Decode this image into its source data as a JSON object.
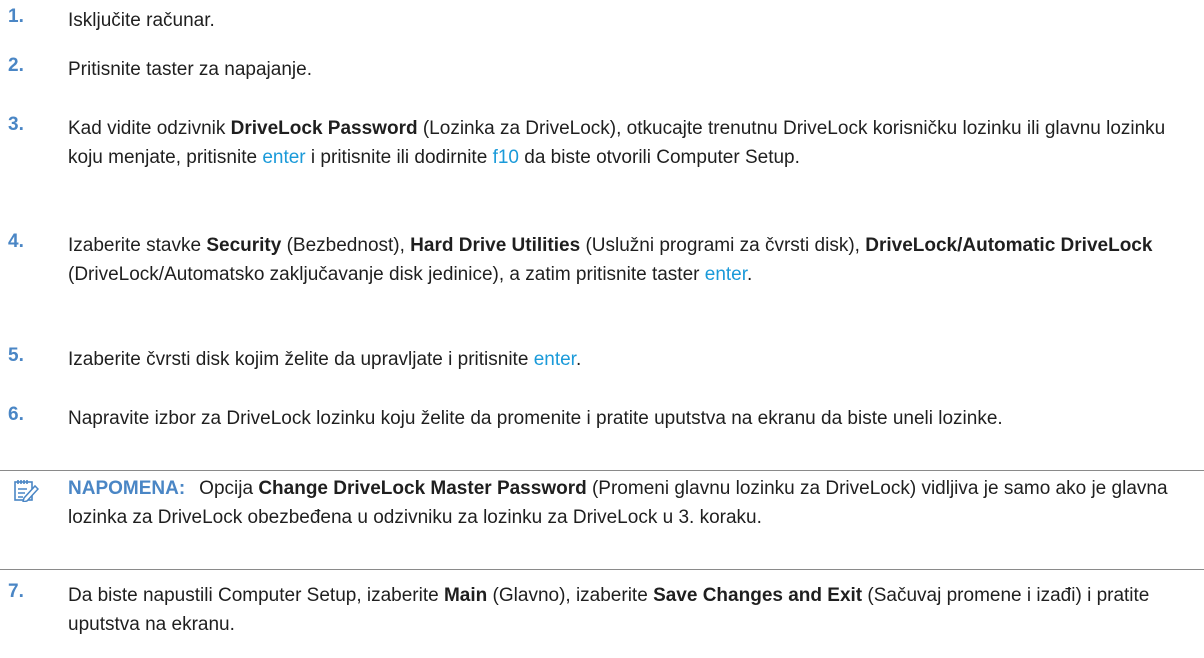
{
  "steps": [
    {
      "num": "1.",
      "parts": [
        {
          "t": "Isključite računar."
        }
      ]
    },
    {
      "num": "2.",
      "parts": [
        {
          "t": "Pritisnite taster za napajanje."
        }
      ]
    },
    {
      "num": "3.",
      "parts": [
        {
          "t": "Kad vidite odzivnik "
        },
        {
          "t": "DriveLock Password",
          "b": true
        },
        {
          "t": " (Lozinka za DriveLock), otkucajte trenutnu DriveLock korisničku lozinku ili glavnu lozinku koju menjate, pritisnite "
        },
        {
          "t": "enter",
          "k": true
        },
        {
          "t": " i pritisnite ili dodirnite "
        },
        {
          "t": "f10",
          "k": true
        },
        {
          "t": " da biste otvorili Computer Setup."
        }
      ]
    },
    {
      "num": "4.",
      "parts": [
        {
          "t": "Izaberite stavke "
        },
        {
          "t": "Security",
          "b": true
        },
        {
          "t": " (Bezbednost), "
        },
        {
          "t": "Hard Drive Utilities",
          "b": true
        },
        {
          "t": " (Uslužni programi za čvrsti disk), "
        },
        {
          "t": "DriveLock/Automatic DriveLock",
          "b": true
        },
        {
          "t": " (DriveLock/Automatsko zaključavanje disk jedinice), a zatim pritisnite taster "
        },
        {
          "t": "enter",
          "k": true
        },
        {
          "t": "."
        }
      ]
    },
    {
      "num": "5.",
      "parts": [
        {
          "t": "Izaberite čvrsti disk kojim želite da upravljate i pritisnite "
        },
        {
          "t": "enter",
          "k": true
        },
        {
          "t": "."
        }
      ]
    },
    {
      "num": "6.",
      "parts": [
        {
          "t": "Napravite izbor za DriveLock lozinku koju želite da promenite i pratite uputstva na ekranu da biste uneli lozinke."
        }
      ]
    }
  ],
  "note": {
    "label": "NAPOMENA:",
    "parts": [
      {
        "t": "Opcija "
      },
      {
        "t": "Change DriveLock Master Password",
        "b": true
      },
      {
        "t": " (Promeni glavnu lozinku za DriveLock) vidljiva je samo ako je glavna lozinka za DriveLock obezbeđena u odzivniku za lozinku za DriveLock u 3. koraku."
      }
    ]
  },
  "step7": {
    "num": "7.",
    "parts": [
      {
        "t": "Da biste napustili Computer Setup, izaberite "
      },
      {
        "t": "Main",
        "b": true
      },
      {
        "t": " (Glavno), izaberite "
      },
      {
        "t": "Save Changes and Exit",
        "b": true
      },
      {
        "t": " (Sačuvaj promene i izađi) i pratite uputstva na ekranu."
      }
    ]
  },
  "colors": {
    "number": "#4a86c5",
    "key": "#1a9ad9",
    "text": "#1f1f1f"
  },
  "icons": {
    "note": "note-pencil-icon"
  }
}
